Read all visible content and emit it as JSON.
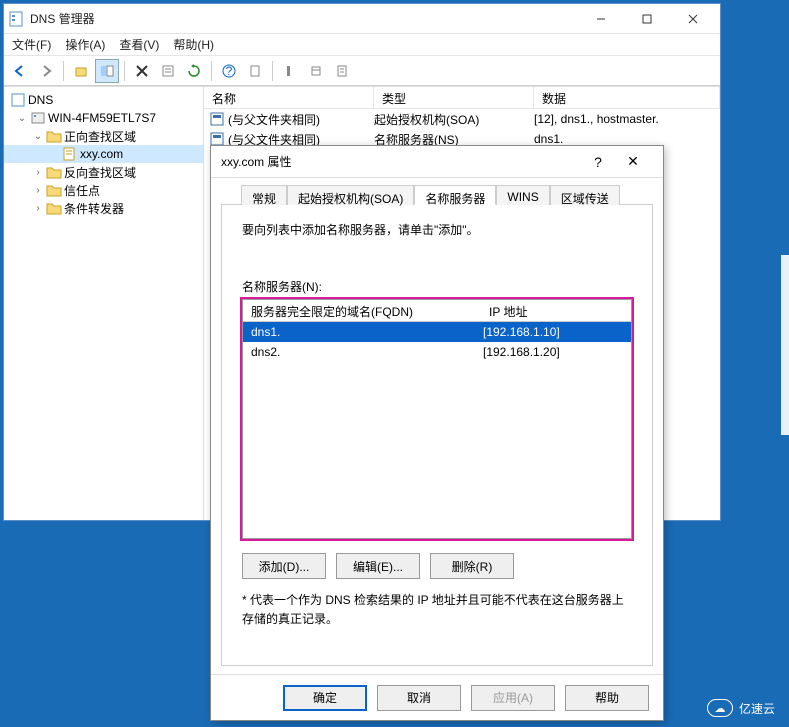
{
  "main": {
    "title": "DNS 管理器",
    "menus": [
      "文件(F)",
      "操作(A)",
      "查看(V)",
      "帮助(H)"
    ],
    "tree": {
      "root": "DNS",
      "server": "WIN-4FM59ETL7S7",
      "items": [
        {
          "label": "正向查找区域",
          "expanded": true,
          "children": [
            {
              "label": "xxy.com",
              "selected": true
            }
          ]
        },
        {
          "label": "反向查找区域"
        },
        {
          "label": "信任点"
        },
        {
          "label": "条件转发器"
        }
      ]
    },
    "list": {
      "headers": {
        "c1": "名称",
        "c2": "类型",
        "c3": "数据"
      },
      "rows": [
        {
          "c1": "(与父文件夹相同)",
          "c2": "起始授权机构(SOA)",
          "c3": "[12], dns1., hostmaster."
        },
        {
          "c1": "(与父文件夹相同)",
          "c2": "名称服务器(NS)",
          "c3": "dns1."
        }
      ]
    }
  },
  "dialog": {
    "title": "xxy.com 属性",
    "tabs": [
      "常规",
      "起始授权机构(SOA)",
      "名称服务器",
      "WINS",
      "区域传送"
    ],
    "active_tab": 2,
    "hint": "要向列表中添加名称服务器，请单击\"添加\"。",
    "ns_label": "名称服务器(N):",
    "ns_headers": {
      "fqdn": "服务器完全限定的域名(FQDN)",
      "ip": "IP 地址"
    },
    "ns_rows": [
      {
        "fqdn": "dns1.",
        "ip": "[192.168.1.10]",
        "selected": true
      },
      {
        "fqdn": "dns2.",
        "ip": "[192.168.1.20]",
        "selected": false
      }
    ],
    "buttons": {
      "add": "添加(D)...",
      "edit": "编辑(E)...",
      "remove": "删除(R)"
    },
    "footnote": "* 代表一个作为 DNS 检索结果的 IP 地址并且可能不代表在这台服务器上存储的真正记录。",
    "footer": {
      "ok": "确定",
      "cancel": "取消",
      "apply": "应用(A)",
      "help": "帮助"
    }
  },
  "watermark": "亿速云"
}
